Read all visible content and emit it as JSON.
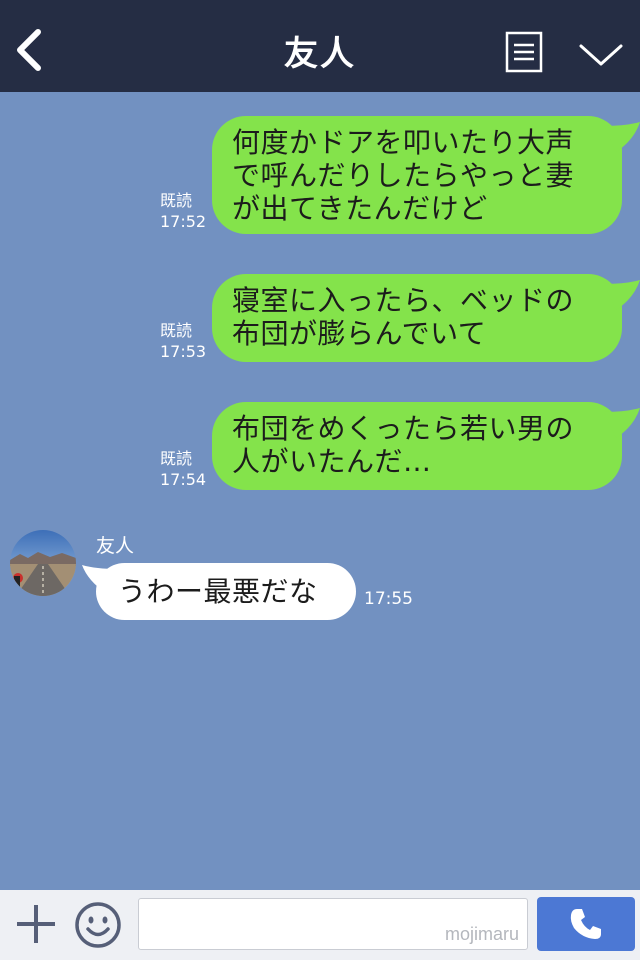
{
  "header": {
    "title": "友人",
    "icons": {
      "back": "back-arrow-icon",
      "notes": "note-list-icon",
      "collapse": "chevron-down-icon"
    }
  },
  "messages_out": [
    {
      "lines": [
        "何度かドアを叩いたり大声",
        "で呼んだりしたらやっと妻",
        "が出てきたんだけど"
      ],
      "read": "既読",
      "time": "17:52"
    },
    {
      "lines": [
        "寝室に入ったら、ベッドの",
        "布団が膨らんでいて"
      ],
      "read": "既読",
      "time": "17:53"
    },
    {
      "lines": [
        "布団をめくったら若い男の",
        "人がいたんだ…"
      ],
      "read": "既読",
      "time": "17:54"
    }
  ],
  "message_in": {
    "sender": "友人",
    "text": "うわー最悪だな",
    "time": "17:55"
  },
  "footer": {
    "watermark": "mojimaru",
    "icons": {
      "add": "plus-icon",
      "sticker": "smiley-icon",
      "call": "phone-icon"
    }
  },
  "colors": {
    "header_bg": "#252d44",
    "chat_bg": "#7291c1",
    "outgoing_bubble": "#84e34b",
    "incoming_bubble": "#ffffff",
    "call_button": "#4c78d4"
  }
}
